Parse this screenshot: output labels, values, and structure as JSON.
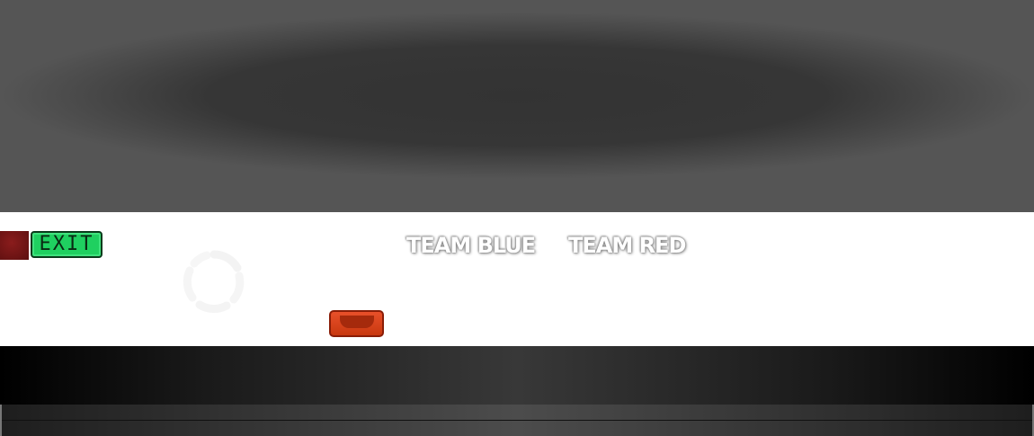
{
  "exit_button": {
    "label": "EXIT"
  },
  "teams": [
    {
      "label": "TEAM BLUE"
    },
    {
      "label": "TEAM RED"
    }
  ],
  "colors": {
    "exit_green": "#1fd060",
    "button_red": "#d9431a",
    "maroon": "#6b1414"
  }
}
